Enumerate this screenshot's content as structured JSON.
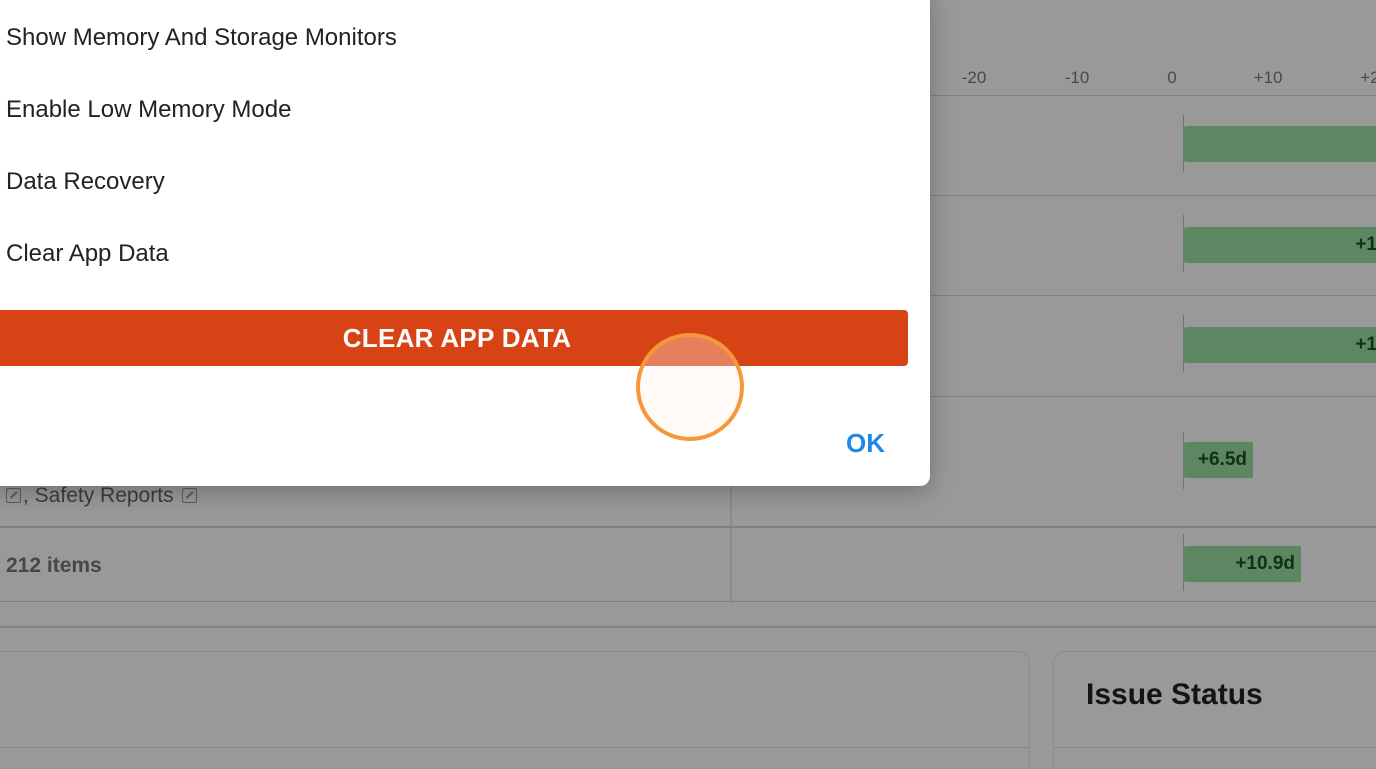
{
  "background": {
    "axis_ticks": [
      "-20",
      "-10",
      "0",
      "+10",
      "+2"
    ],
    "rows": [
      {
        "bar_label": ""
      },
      {
        "bar_label": "+1"
      },
      {
        "bar_label": "+1"
      },
      {
        "bar_label": "+6.5d",
        "row_text": ", Safety Reports"
      },
      {
        "bar_label": "+10.9d",
        "row_text": "212 items"
      }
    ],
    "card_right_title": "Issue Status",
    "bar_color": "#9ce0a6"
  },
  "dialog": {
    "menu_items": [
      "Show Memory And Storage Monitors",
      "Enable Low Memory Mode",
      "Data Recovery",
      "Clear App Data"
    ],
    "clear_button_label": "CLEAR APP DATA",
    "ok_button_label": "OK",
    "clear_button_color": "#d84315",
    "ok_color": "#1e88e5"
  }
}
